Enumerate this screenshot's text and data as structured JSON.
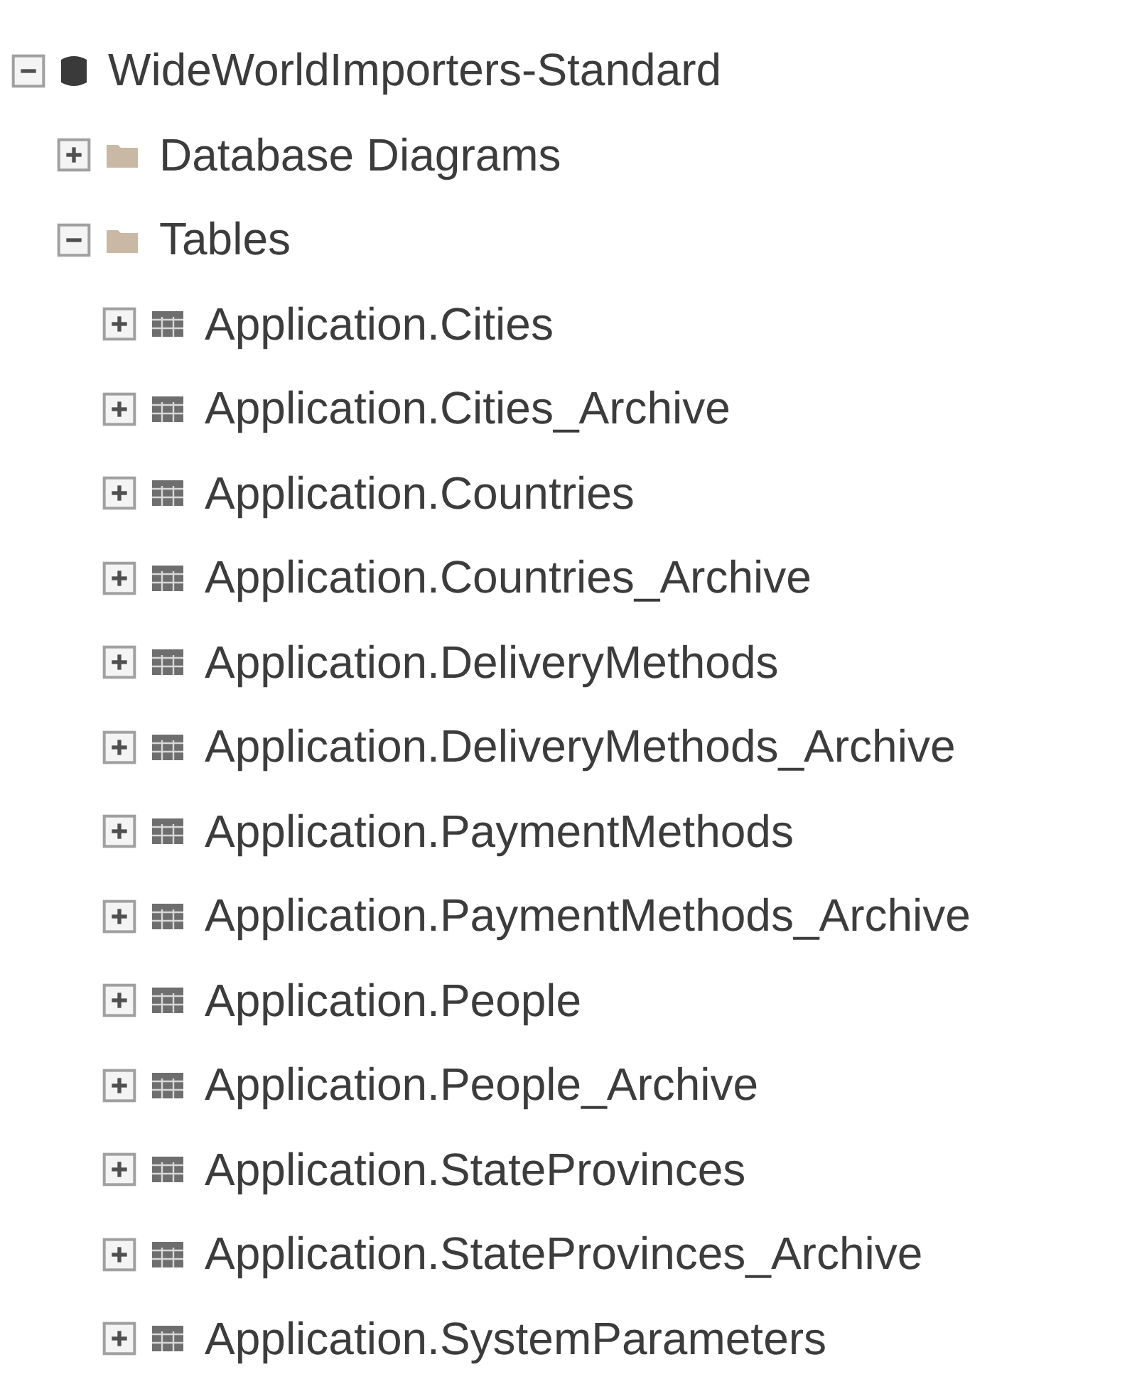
{
  "tree": [
    {
      "label": "WideWorldImporters-Standard",
      "kind": "database",
      "expanded": true,
      "children": [
        {
          "label": "Database Diagrams",
          "kind": "folder",
          "expanded": false
        },
        {
          "label": "Tables",
          "kind": "folder",
          "expanded": true,
          "children": [
            {
              "label": "Application.Cities",
              "kind": "table",
              "expanded": false
            },
            {
              "label": "Application.Cities_Archive",
              "kind": "table",
              "expanded": false
            },
            {
              "label": "Application.Countries",
              "kind": "table",
              "expanded": false
            },
            {
              "label": "Application.Countries_Archive",
              "kind": "table",
              "expanded": false
            },
            {
              "label": "Application.DeliveryMethods",
              "kind": "table",
              "expanded": false
            },
            {
              "label": "Application.DeliveryMethods_Archive",
              "kind": "table",
              "expanded": false
            },
            {
              "label": "Application.PaymentMethods",
              "kind": "table",
              "expanded": false
            },
            {
              "label": "Application.PaymentMethods_Archive",
              "kind": "table",
              "expanded": false
            },
            {
              "label": "Application.People",
              "kind": "table",
              "expanded": false
            },
            {
              "label": "Application.People_Archive",
              "kind": "table",
              "expanded": false
            },
            {
              "label": "Application.StateProvinces",
              "kind": "table",
              "expanded": false
            },
            {
              "label": "Application.StateProvinces_Archive",
              "kind": "table",
              "expanded": false
            },
            {
              "label": "Application.SystemParameters",
              "kind": "table",
              "expanded": false
            }
          ]
        }
      ]
    }
  ]
}
